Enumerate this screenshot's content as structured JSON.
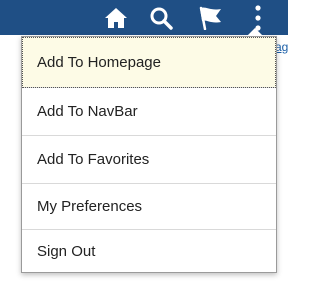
{
  "header": {
    "icons": {
      "home": "home-icon",
      "search": "search-icon",
      "notifications": "flag-icon",
      "actions": "vertical-dots-icon"
    },
    "background_color": "#1f4f85"
  },
  "behind_text": "ag",
  "actions_menu": {
    "items": [
      {
        "label": "Add To Homepage",
        "highlighted": true
      },
      {
        "label": "Add To NavBar"
      },
      {
        "label": "Add To Favorites"
      },
      {
        "label": "My Preferences"
      },
      {
        "label": "Sign Out"
      }
    ]
  }
}
